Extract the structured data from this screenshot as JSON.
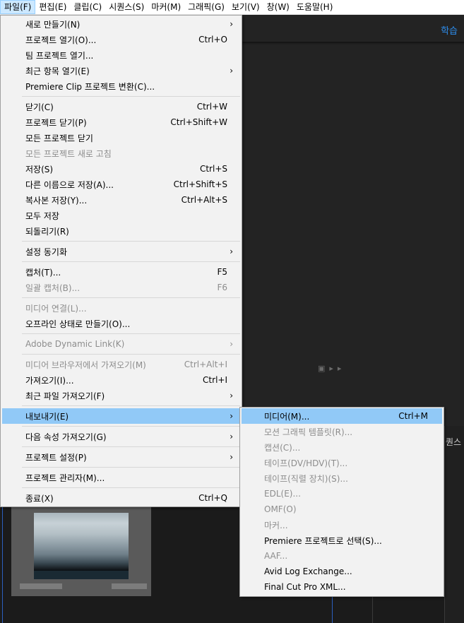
{
  "menubar": {
    "items": [
      {
        "label": "파일(F)"
      },
      {
        "label": "편집(E)"
      },
      {
        "label": "클립(C)"
      },
      {
        "label": "시퀀스(S)"
      },
      {
        "label": "마커(M)"
      },
      {
        "label": "그래픽(G)"
      },
      {
        "label": "보기(V)"
      },
      {
        "label": "창(W)"
      },
      {
        "label": "도움말(H)"
      }
    ]
  },
  "workspace": {
    "learn_tab": "학습",
    "sequence_fragment": "퀀스"
  },
  "file_menu": {
    "items": [
      {
        "label": "새로 만들기(N)",
        "shortcut": "",
        "submenu": true
      },
      {
        "label": "프로젝트 열기(O)...",
        "shortcut": "Ctrl+O"
      },
      {
        "label": "팀 프로젝트 열기...",
        "shortcut": ""
      },
      {
        "label": "최근 항목 열기(E)",
        "shortcut": "",
        "submenu": true
      },
      {
        "label": "Premiere Clip 프로젝트 변환(C)...",
        "shortcut": ""
      },
      {
        "label": "닫기(C)",
        "shortcut": "Ctrl+W"
      },
      {
        "label": "프로젝트 닫기(P)",
        "shortcut": "Ctrl+Shift+W"
      },
      {
        "label": "모든 프로젝트 닫기",
        "shortcut": ""
      },
      {
        "label": "모든 프로젝트 새로 고침",
        "shortcut": "",
        "disabled": true
      },
      {
        "label": "저장(S)",
        "shortcut": "Ctrl+S"
      },
      {
        "label": "다른 이름으로 저장(A)...",
        "shortcut": "Ctrl+Shift+S"
      },
      {
        "label": "복사본 저장(Y)...",
        "shortcut": "Ctrl+Alt+S"
      },
      {
        "label": "모두 저장",
        "shortcut": ""
      },
      {
        "label": "되돌리기(R)",
        "shortcut": ""
      },
      {
        "label": "설정 동기화",
        "shortcut": "",
        "submenu": true
      },
      {
        "label": "캡처(T)...",
        "shortcut": "F5"
      },
      {
        "label": "일괄 캡처(B)...",
        "shortcut": "F6",
        "disabled": true
      },
      {
        "label": "미디어 연결(L)...",
        "shortcut": "",
        "disabled": true
      },
      {
        "label": "오프라인 상태로 만들기(O)...",
        "shortcut": ""
      },
      {
        "label": "Adobe Dynamic Link(K)",
        "shortcut": "",
        "submenu": true,
        "disabled": true
      },
      {
        "label": "미디어 브라우저에서 가져오기(M)",
        "shortcut": "Ctrl+Alt+I",
        "disabled": true
      },
      {
        "label": "가져오기(I)...",
        "shortcut": "Ctrl+I"
      },
      {
        "label": "최근 파일 가져오기(F)",
        "shortcut": "",
        "submenu": true
      },
      {
        "label": "내보내기(E)",
        "shortcut": "",
        "submenu": true,
        "highlight": true
      },
      {
        "label": "다음 속성 가져오기(G)",
        "shortcut": "",
        "submenu": true
      },
      {
        "label": "프로젝트 설정(P)",
        "shortcut": "",
        "submenu": true
      },
      {
        "label": "프로젝트 관리자(M)...",
        "shortcut": ""
      },
      {
        "label": "종료(X)",
        "shortcut": "Ctrl+Q"
      }
    ]
  },
  "export_menu": {
    "items": [
      {
        "label": "미디어(M)...",
        "shortcut": "Ctrl+M",
        "highlight": true
      },
      {
        "label": "모션 그래픽 템플릿(R)...",
        "shortcut": "",
        "disabled": true
      },
      {
        "label": "캡션(C)...",
        "shortcut": "",
        "disabled": true
      },
      {
        "label": "테이프(DV/HDV)(T)...",
        "shortcut": "",
        "disabled": true
      },
      {
        "label": "테이프(직렬 장치)(S)...",
        "shortcut": "",
        "disabled": true
      },
      {
        "label": "EDL(E)...",
        "shortcut": "",
        "disabled": true
      },
      {
        "label": "OMF(O)",
        "shortcut": "",
        "disabled": true
      },
      {
        "label": "마커...",
        "shortcut": "",
        "disabled": true
      },
      {
        "label": "Premiere 프로젝트로 선택(S)...",
        "shortcut": ""
      },
      {
        "label": "AAF...",
        "shortcut": "",
        "disabled": true
      },
      {
        "label": "Avid Log Exchange...",
        "shortcut": ""
      },
      {
        "label": "Final Cut Pro XML...",
        "shortcut": ""
      }
    ]
  },
  "colors": {
    "highlight": "#91c9f7",
    "menu_bg": "#f2f2f2",
    "accent_blue": "#2d8ceb",
    "app_bg": "#232323"
  }
}
